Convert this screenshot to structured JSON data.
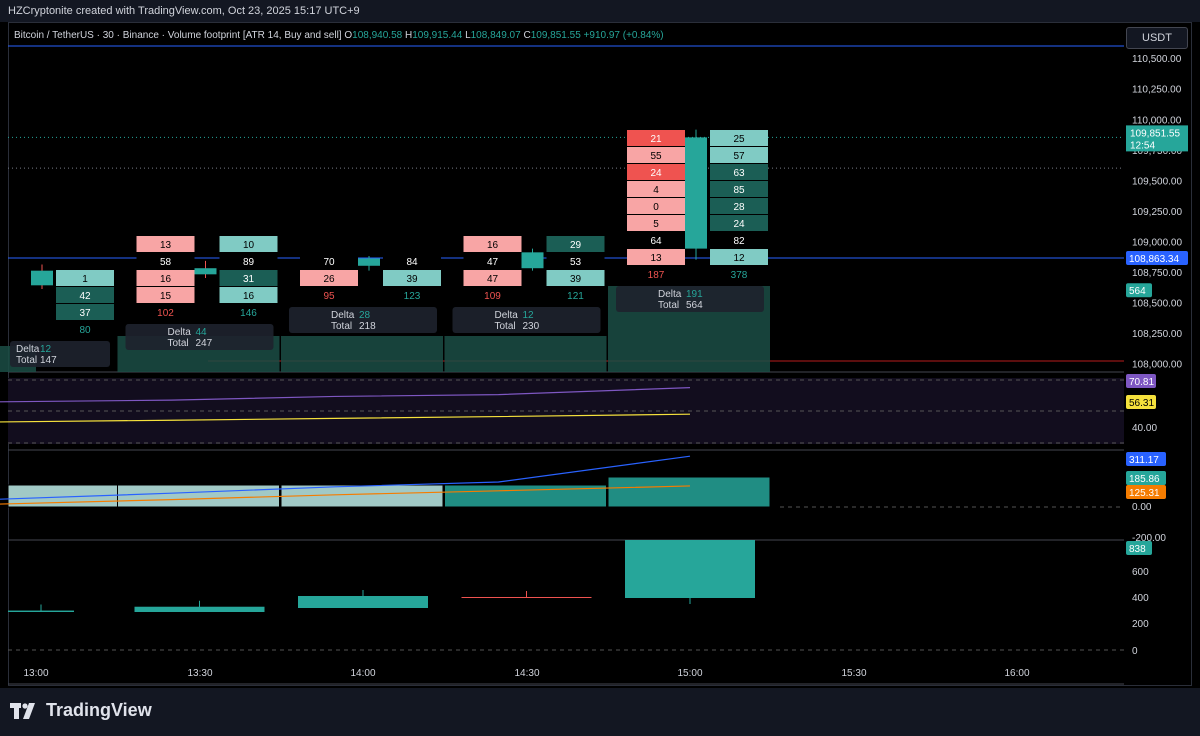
{
  "header": {
    "credit": "HZCryptonite created with TradingView.com, Oct 23, 2025 15:17 UTC+9",
    "symbol_line": "Bitcoin / TetherUS · 30 · Binance · Volume footprint [ATR 14, Buy and sell]",
    "ohlc": {
      "o_key": "O",
      "o": "108,940.58",
      "h_key": "H",
      "h": "109,915.44",
      "l_key": "L",
      "l": "108,849.07",
      "c_key": "C",
      "c": "109,851.55",
      "change": "+910.97 (+0.84%)"
    },
    "currency_button": "USDT"
  },
  "colors": {
    "up": "#26a69a",
    "down": "#ef5350",
    "buy_light": "#80cbc4",
    "sell_light": "#f8a5a5",
    "buy_dark": "#1b5e55",
    "sell_dark": "#a8323c",
    "poc": "#000000",
    "price_line": "#2962ff",
    "rsi_line": "#7e57c2",
    "rsi_ma": "#f5e13c",
    "cvd_line": "#2962ff",
    "cvd_ma": "#f57c00"
  },
  "time_axis": [
    "13:00",
    "13:30",
    "14:00",
    "14:30",
    "15:00",
    "15:30",
    "16:00"
  ],
  "chart_data": [
    {
      "type": "candlestick",
      "pane": "price",
      "symbol": "Bitcoin / TetherUS",
      "interval": "30",
      "price_axis_labels": [
        "110,500.00",
        "110,250.00",
        "110,000.00",
        "109,750.00",
        "109,500.00",
        "109,250.00",
        "109,000.00",
        "108,750.00",
        "108,500.00",
        "108,250.00",
        "108,000.00"
      ],
      "current_price_label": "109,851.55",
      "countdown": "12:54",
      "level_label": "108,863.34",
      "volume_label": "564",
      "candles": [
        {
          "time": "13:00",
          "open": 108760,
          "high": 108810,
          "low": 108610,
          "close": 108640
        },
        {
          "time": "13:30",
          "open": 108780,
          "high": 108840,
          "low": 108700,
          "close": 108730
        },
        {
          "time": "14:00",
          "open": 108800,
          "high": 108880,
          "low": 108760,
          "close": 108860
        },
        {
          "time": "14:30",
          "open": 108780,
          "high": 108940,
          "low": 108760,
          "close": 108910
        },
        {
          "time": "15:00",
          "open": 108940.58,
          "high": 109915.44,
          "low": 108849.07,
          "close": 109851.55
        }
      ],
      "footprints": [
        {
          "time": "13:00",
          "rows": [
            {
              "sell": "",
              "buy": "1"
            },
            {
              "sell": "",
              "buy": "42"
            },
            {
              "sell": "",
              "buy": "37"
            }
          ],
          "sell_total": "",
          "buy_total": "80",
          "delta": "12",
          "total": "147"
        },
        {
          "time": "13:30",
          "rows": [
            {
              "sell": "13",
              "buy": "10"
            },
            {
              "sell": "58",
              "buy": "89"
            },
            {
              "sell": "16",
              "buy": "31"
            },
            {
              "sell": "15",
              "buy": "16"
            }
          ],
          "sell_total": "102",
          "buy_total": "146",
          "delta": "44",
          "total": "247"
        },
        {
          "time": "14:00",
          "rows": [
            {
              "sell": "70",
              "buy": "84"
            },
            {
              "sell": "26",
              "buy": "39"
            }
          ],
          "sell_total": "95",
          "buy_total": "123",
          "delta": "28",
          "total": "218"
        },
        {
          "time": "14:30",
          "rows": [
            {
              "sell": "16",
              "buy": "29"
            },
            {
              "sell": "47",
              "buy": "53"
            },
            {
              "sell": "47",
              "buy": "39"
            }
          ],
          "sell_total": "109",
          "buy_total": "121",
          "delta": "12",
          "total": "230"
        },
        {
          "time": "15:00",
          "rows": [
            {
              "sell": "21",
              "buy": "25"
            },
            {
              "sell": "55",
              "buy": "57"
            },
            {
              "sell": "24",
              "buy": "63"
            },
            {
              "sell": "4",
              "buy": "85"
            },
            {
              "sell": "0",
              "buy": "28"
            },
            {
              "sell": "5",
              "buy": "24"
            },
            {
              "sell": "64",
              "buy": "82"
            },
            {
              "sell": "13",
              "buy": "12"
            }
          ],
          "sell_total": "187",
          "buy_total": "378",
          "delta": "191",
          "total": "564"
        }
      ],
      "delta_label": "Delta",
      "total_label": "Total"
    },
    {
      "type": "line",
      "pane": "rsi",
      "axis_labels": [
        "40.00"
      ],
      "series": [
        {
          "values": [
            63,
            64,
            66,
            67,
            70.81
          ]
        },
        {
          "values": [
            52,
            53,
            54,
            55,
            56.31
          ]
        }
      ],
      "value_labels": [
        "70.81",
        "56.31"
      ]
    },
    {
      "type": "line",
      "pane": "cvd",
      "axis_labels": [
        "0.00",
        "-200.00"
      ],
      "bars": [
        147,
        247,
        218,
        230,
        564
      ],
      "series": [
        {
          "values": [
            40,
            80,
            120,
            150,
            311.17
          ]
        },
        {
          "values": [
            10,
            40,
            70,
            95,
            125.31
          ]
        }
      ],
      "value_labels": [
        "311.17",
        "185.86",
        "125.31"
      ]
    },
    {
      "type": "bar",
      "pane": "delta_histogram",
      "axis_labels": [
        "800",
        "600",
        "400",
        "200",
        "0"
      ],
      "values": [
        12,
        44,
        100,
        1,
        838
      ],
      "value_label": "838"
    }
  ]
}
